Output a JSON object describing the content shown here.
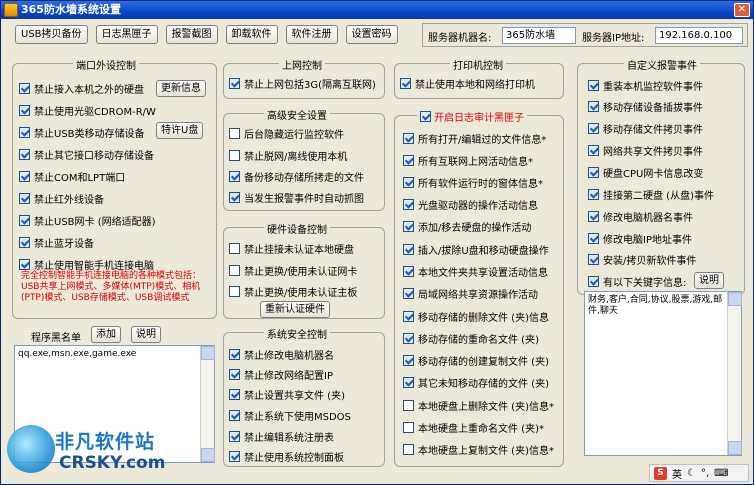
{
  "window": {
    "title": "365防水墙系统设置"
  },
  "toolbar": {
    "buttons": [
      "USB拷贝备份",
      "日志黑匣子",
      "报警截图",
      "卸载软件",
      "软件注册",
      "设置密码"
    ]
  },
  "server": {
    "name_label": "服务器机器名:",
    "name_value": "365防水墙",
    "ip_label": "服务器IP地址:",
    "ip_value": "192.168.0.100"
  },
  "port_control": {
    "title": "端口外设控制",
    "items": [
      {
        "label": "禁止接入本机之外的硬盘",
        "checked": true
      },
      {
        "label": "禁止使用光驱CDROM-R/W",
        "checked": true
      },
      {
        "label": "禁止USB类移动存储设备",
        "checked": true
      },
      {
        "label": "禁止其它接口移动存储设备",
        "checked": true
      },
      {
        "label": "禁止COM和LPT端口",
        "checked": true
      },
      {
        "label": "禁止红外线设备",
        "checked": true
      },
      {
        "label": "禁止USB网卡 (网络适配器)",
        "checked": true
      },
      {
        "label": "禁止蓝牙设备",
        "checked": true
      },
      {
        "label": "禁止使用智能手机连接电脑",
        "checked": true
      }
    ],
    "update_btn": "更新信息",
    "whitelist_btn": "特许U盘",
    "warning": "完全控制智能手机连接电脑的各种模式包括：USB共享上网模式、多媒体(MTP)模式、相机(PTP)模式、USB存储模式、USB调试模式"
  },
  "blacklist": {
    "label": "程序黑名单",
    "add_btn": "添加",
    "help_btn": "说明",
    "content": "qq.exe,msn.exe,game.exe"
  },
  "net_control": {
    "title": "上网控制",
    "items": [
      {
        "label": "禁止上网包括3G(隔离互联网)",
        "checked": true
      }
    ]
  },
  "security": {
    "title": "高级安全设置",
    "items": [
      {
        "label": "后台隐藏运行监控软件",
        "checked": false
      },
      {
        "label": "禁止脱网/离线使用本机",
        "checked": false
      },
      {
        "label": "备份移动存储所拷走的文件",
        "checked": true
      },
      {
        "label": "当发生报警事件时自动抓图",
        "checked": true
      }
    ]
  },
  "hardware": {
    "title": "硬件设备控制",
    "items": [
      {
        "label": "禁止挂接未认证本地硬盘",
        "checked": false
      },
      {
        "label": "禁止更换/使用未认证网卡",
        "checked": false
      },
      {
        "label": "禁止更换/使用未认证主板",
        "checked": false
      }
    ],
    "reauth_btn": "重新认证硬件"
  },
  "system": {
    "title": "系统安全控制",
    "items": [
      {
        "label": "禁止修改电脑机器名",
        "checked": true
      },
      {
        "label": "禁止修改网络配置IP",
        "checked": true
      },
      {
        "label": "禁止设置共享文件 (夹)",
        "checked": true
      },
      {
        "label": "禁止系统下使用MSDOS",
        "checked": true
      },
      {
        "label": "禁止编辑系统注册表",
        "checked": true
      },
      {
        "label": "禁止使用系统控制面板",
        "checked": true
      }
    ]
  },
  "print": {
    "title": "打印机控制",
    "items": [
      {
        "label": "禁止使用本地和网络打印机",
        "checked": true
      }
    ]
  },
  "audit": {
    "title": "开启日志审计黑匣子",
    "title_checked": true,
    "items": [
      {
        "label": "所有打开/编辑过的文件信息*",
        "checked": true
      },
      {
        "label": "所有互联网上网活动信息*",
        "checked": true
      },
      {
        "label": "所有软件运行时的窗体信息*",
        "checked": true
      },
      {
        "label": "光盘驱动器的操作活动信息",
        "checked": true
      },
      {
        "label": "添加/移去硬盘的操作活动",
        "checked": true
      },
      {
        "label": "插入/拔除U盘和移动硬盘操作",
        "checked": true
      },
      {
        "label": "本地文件夹共享设置活动信息",
        "checked": true
      },
      {
        "label": "局域网络共享资源操作活动",
        "checked": true
      },
      {
        "label": "移动存储的删除文件 (夹)信息",
        "checked": true
      },
      {
        "label": "移动存储的重命名文件 (夹)",
        "checked": true
      },
      {
        "label": "移动存储的创建复制文件 (夹)",
        "checked": true
      },
      {
        "label": "其它未知移动存储的文件 (夹)",
        "checked": true
      },
      {
        "label": "本地硬盘上删除文件 (夹)信息*",
        "checked": false
      },
      {
        "label": "本地硬盘上重命名文件 (夹)*",
        "checked": false
      },
      {
        "label": "本地硬盘上复制文件 (夹)信息*",
        "checked": false
      }
    ]
  },
  "custom_alarm": {
    "title": "自定义报警事件",
    "items": [
      {
        "label": "重装本机监控软件事件",
        "checked": true
      },
      {
        "label": "移动存储设备插拔事件",
        "checked": true
      },
      {
        "label": "移动存储文件拷贝事件",
        "checked": true
      },
      {
        "label": "网络共享文件拷贝事件",
        "checked": true
      },
      {
        "label": "硬盘CPU网卡信息改变",
        "checked": true
      },
      {
        "label": "挂接第二硬盘 (从盘)事件",
        "checked": true
      },
      {
        "label": "修改电脑机器名事件",
        "checked": true
      },
      {
        "label": "修改电脑IP地址事件",
        "checked": true
      },
      {
        "label": "安装/拷贝新软件事件",
        "checked": true
      },
      {
        "label": "有以下关键字信息:",
        "checked": true
      }
    ],
    "help_btn": "说明",
    "keywords": "财务,客户,合同,协议,股票,游戏,邮件,聊天"
  },
  "watermark": {
    "cn": "非凡软件站",
    "en": "CRSKY.com"
  },
  "ime": {
    "label": "英"
  },
  "colors": {
    "title_bar": "#0a46c8",
    "warning": "#e00000",
    "accent_check": "#2156b0"
  }
}
